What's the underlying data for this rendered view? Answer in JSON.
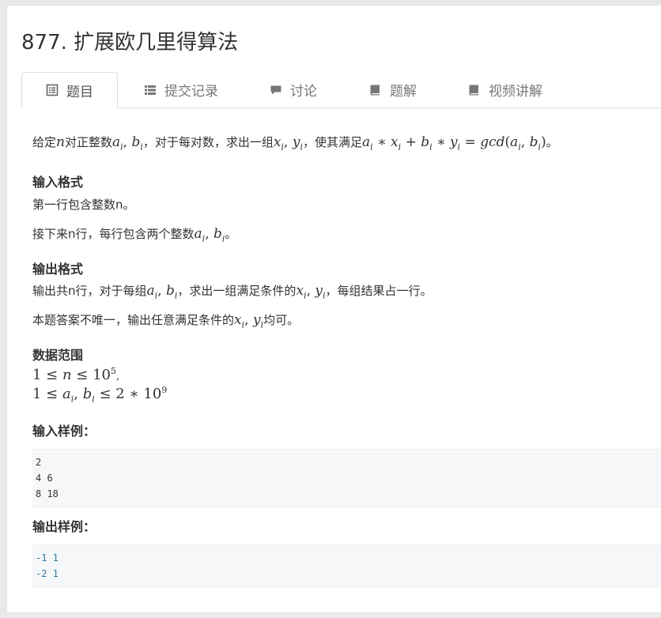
{
  "problem": {
    "title": "877. 扩展欧几里得算法"
  },
  "tabs": [
    {
      "label": "题目",
      "icon": "document-icon",
      "active": true
    },
    {
      "label": "提交记录",
      "icon": "list-icon",
      "active": false
    },
    {
      "label": "讨论",
      "icon": "comment-icon",
      "active": false
    },
    {
      "label": "题解",
      "icon": "book-icon",
      "active": false
    },
    {
      "label": "视频讲解",
      "icon": "book-icon",
      "active": false
    }
  ],
  "statement": {
    "intro_a": "给定",
    "intro_n": "n",
    "intro_b": "对正整数",
    "intro_ab": "a",
    "intro_c": "，对于每对数，求出一组",
    "intro_d": "，使其满足",
    "intro_e": "。"
  },
  "input_format": {
    "heading": "输入格式",
    "line1": "第一行包含整数n。",
    "line2_prefix": "接下来n行，每行包含两个整数",
    "line2_suffix": "。"
  },
  "output_format": {
    "heading": "输出格式",
    "line1_prefix": "输出共n行，对于每组",
    "line1_mid": "，求出一组满足条件的",
    "line1_suffix": "，每组结果占一行。",
    "line2_prefix": "本题答案不唯一，输出任意满足条件的",
    "line2_suffix": "均可。"
  },
  "data_range": {
    "heading": "数据范围"
  },
  "sample_input": {
    "heading": "输入样例：",
    "lines": [
      "2",
      "4 6",
      "8 18"
    ]
  },
  "sample_output": {
    "heading": "输出样例：",
    "lines": [
      "-1 1",
      "-2 1"
    ]
  },
  "colors": {
    "accent_code_output": "#2a7aa8",
    "code_bg": "#f6f7f8"
  }
}
